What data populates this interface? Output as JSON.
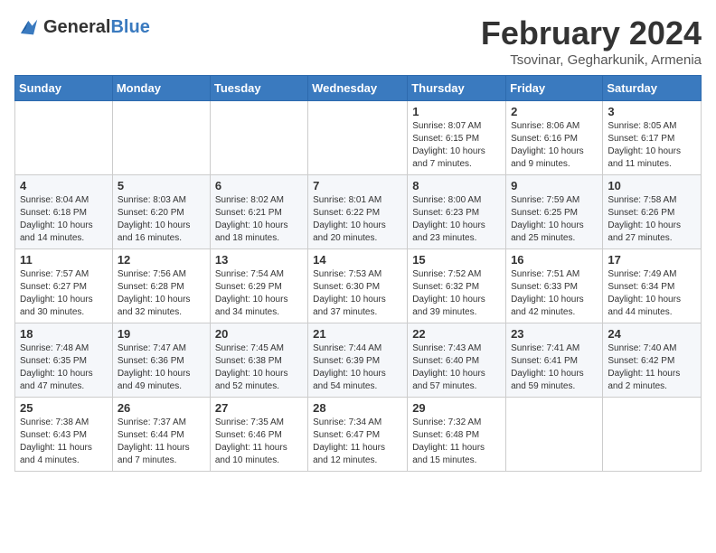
{
  "header": {
    "logo_general": "General",
    "logo_blue": "Blue",
    "title": "February 2024",
    "subtitle": "Tsovinar, Gegharkunik, Armenia"
  },
  "days_of_week": [
    "Sunday",
    "Monday",
    "Tuesday",
    "Wednesday",
    "Thursday",
    "Friday",
    "Saturday"
  ],
  "weeks": [
    [
      {
        "day": "",
        "info": ""
      },
      {
        "day": "",
        "info": ""
      },
      {
        "day": "",
        "info": ""
      },
      {
        "day": "",
        "info": ""
      },
      {
        "day": "1",
        "info": "Sunrise: 8:07 AM\nSunset: 6:15 PM\nDaylight: 10 hours and 7 minutes."
      },
      {
        "day": "2",
        "info": "Sunrise: 8:06 AM\nSunset: 6:16 PM\nDaylight: 10 hours and 9 minutes."
      },
      {
        "day": "3",
        "info": "Sunrise: 8:05 AM\nSunset: 6:17 PM\nDaylight: 10 hours and 11 minutes."
      }
    ],
    [
      {
        "day": "4",
        "info": "Sunrise: 8:04 AM\nSunset: 6:18 PM\nDaylight: 10 hours and 14 minutes."
      },
      {
        "day": "5",
        "info": "Sunrise: 8:03 AM\nSunset: 6:20 PM\nDaylight: 10 hours and 16 minutes."
      },
      {
        "day": "6",
        "info": "Sunrise: 8:02 AM\nSunset: 6:21 PM\nDaylight: 10 hours and 18 minutes."
      },
      {
        "day": "7",
        "info": "Sunrise: 8:01 AM\nSunset: 6:22 PM\nDaylight: 10 hours and 20 minutes."
      },
      {
        "day": "8",
        "info": "Sunrise: 8:00 AM\nSunset: 6:23 PM\nDaylight: 10 hours and 23 minutes."
      },
      {
        "day": "9",
        "info": "Sunrise: 7:59 AM\nSunset: 6:25 PM\nDaylight: 10 hours and 25 minutes."
      },
      {
        "day": "10",
        "info": "Sunrise: 7:58 AM\nSunset: 6:26 PM\nDaylight: 10 hours and 27 minutes."
      }
    ],
    [
      {
        "day": "11",
        "info": "Sunrise: 7:57 AM\nSunset: 6:27 PM\nDaylight: 10 hours and 30 minutes."
      },
      {
        "day": "12",
        "info": "Sunrise: 7:56 AM\nSunset: 6:28 PM\nDaylight: 10 hours and 32 minutes."
      },
      {
        "day": "13",
        "info": "Sunrise: 7:54 AM\nSunset: 6:29 PM\nDaylight: 10 hours and 34 minutes."
      },
      {
        "day": "14",
        "info": "Sunrise: 7:53 AM\nSunset: 6:30 PM\nDaylight: 10 hours and 37 minutes."
      },
      {
        "day": "15",
        "info": "Sunrise: 7:52 AM\nSunset: 6:32 PM\nDaylight: 10 hours and 39 minutes."
      },
      {
        "day": "16",
        "info": "Sunrise: 7:51 AM\nSunset: 6:33 PM\nDaylight: 10 hours and 42 minutes."
      },
      {
        "day": "17",
        "info": "Sunrise: 7:49 AM\nSunset: 6:34 PM\nDaylight: 10 hours and 44 minutes."
      }
    ],
    [
      {
        "day": "18",
        "info": "Sunrise: 7:48 AM\nSunset: 6:35 PM\nDaylight: 10 hours and 47 minutes."
      },
      {
        "day": "19",
        "info": "Sunrise: 7:47 AM\nSunset: 6:36 PM\nDaylight: 10 hours and 49 minutes."
      },
      {
        "day": "20",
        "info": "Sunrise: 7:45 AM\nSunset: 6:38 PM\nDaylight: 10 hours and 52 minutes."
      },
      {
        "day": "21",
        "info": "Sunrise: 7:44 AM\nSunset: 6:39 PM\nDaylight: 10 hours and 54 minutes."
      },
      {
        "day": "22",
        "info": "Sunrise: 7:43 AM\nSunset: 6:40 PM\nDaylight: 10 hours and 57 minutes."
      },
      {
        "day": "23",
        "info": "Sunrise: 7:41 AM\nSunset: 6:41 PM\nDaylight: 10 hours and 59 minutes."
      },
      {
        "day": "24",
        "info": "Sunrise: 7:40 AM\nSunset: 6:42 PM\nDaylight: 11 hours and 2 minutes."
      }
    ],
    [
      {
        "day": "25",
        "info": "Sunrise: 7:38 AM\nSunset: 6:43 PM\nDaylight: 11 hours and 4 minutes."
      },
      {
        "day": "26",
        "info": "Sunrise: 7:37 AM\nSunset: 6:44 PM\nDaylight: 11 hours and 7 minutes."
      },
      {
        "day": "27",
        "info": "Sunrise: 7:35 AM\nSunset: 6:46 PM\nDaylight: 11 hours and 10 minutes."
      },
      {
        "day": "28",
        "info": "Sunrise: 7:34 AM\nSunset: 6:47 PM\nDaylight: 11 hours and 12 minutes."
      },
      {
        "day": "29",
        "info": "Sunrise: 7:32 AM\nSunset: 6:48 PM\nDaylight: 11 hours and 15 minutes."
      },
      {
        "day": "",
        "info": ""
      },
      {
        "day": "",
        "info": ""
      }
    ]
  ]
}
